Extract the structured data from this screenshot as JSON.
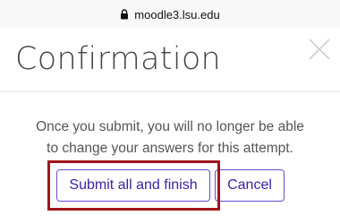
{
  "browser": {
    "url": "moodle3.lsu.edu",
    "lock_icon": "lock-icon"
  },
  "modal": {
    "title": "Confirmation",
    "close_icon": "close-icon",
    "message_line1": "Once you submit, you will no longer be able",
    "message_line2": "to change your answers for this attempt.",
    "submit_label": "Submit all and finish",
    "cancel_label": "Cancel"
  },
  "colors": {
    "accent": "#3c1fa1",
    "button_border": "#6b4bd6",
    "highlight": "#a0151c",
    "title_text": "#444444",
    "body_text": "#555555"
  }
}
